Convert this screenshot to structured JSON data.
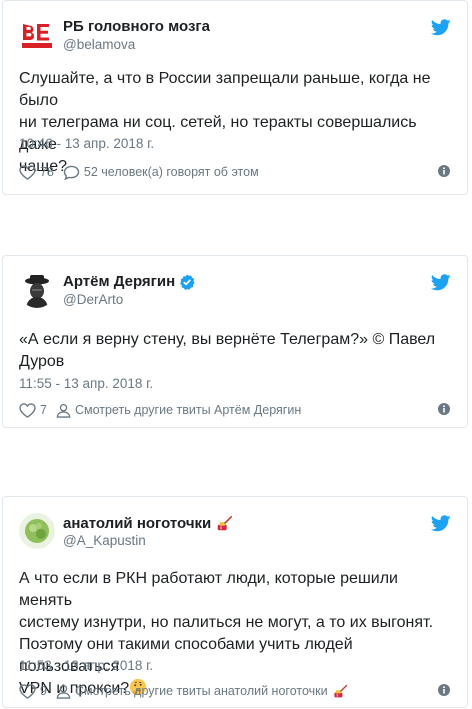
{
  "tweets": [
    {
      "name": "РБ головного мозга",
      "handle": "@belamova",
      "avatar_text": "BELAMOVA",
      "verified": false,
      "text_lines": [
        "Слушайте, а что в России запрещали раньше, когда не было",
        "ни телеграма ни соц. сетей, но теракты совершались даже",
        "чаще?"
      ],
      "timestamp": "10:46 - 13 апр. 2018 г.",
      "like_count": "78",
      "reply_text": "52 человек(а) говорят об этом"
    },
    {
      "name": "Артём Дерягин",
      "handle": "@DerArto",
      "verified": true,
      "text_lines": [
        "«А если я верну стену, вы вернёте Телеграм?» © Павел",
        "Дуров"
      ],
      "timestamp": "11:55 - 13 апр. 2018 г.",
      "like_count": "7",
      "profile_link": "Смотреть другие твиты Артём Дерягин"
    },
    {
      "name": "анатолий ноготочки",
      "handle": "@A_Kapustin",
      "verified": false,
      "text_lines": [
        "А что если в РКН работают люди, которые решили менять",
        "систему изнутри, но палиться не могут, а то их выгонят.",
        "Поэтому они такими способами учить людей пользоваться",
        "VPN и прокси?"
      ],
      "timestamp": "11:53 - 13 апр. 2018 г.",
      "like_count": "9",
      "profile_link": "Смотреть другие твиты анатолий ноготочки"
    }
  ],
  "icons": {
    "twitter": "twitter-bird-icon",
    "like": "heart-icon",
    "reply": "reply-bubble-icon",
    "profile": "person-icon",
    "info": "info-icon",
    "verified": "verified-badge-icon",
    "nail_emoji": "nail-polish-emoji",
    "thinking_emoji": "thinking-face-emoji"
  },
  "colors": {
    "twitter_blue": "#1da1f2",
    "verified_blue": "#1da1f2",
    "secondary_text": "#697882",
    "primary_text": "#1c2022",
    "link": "#2b7bb9",
    "card_border": "#e1e8ed"
  }
}
